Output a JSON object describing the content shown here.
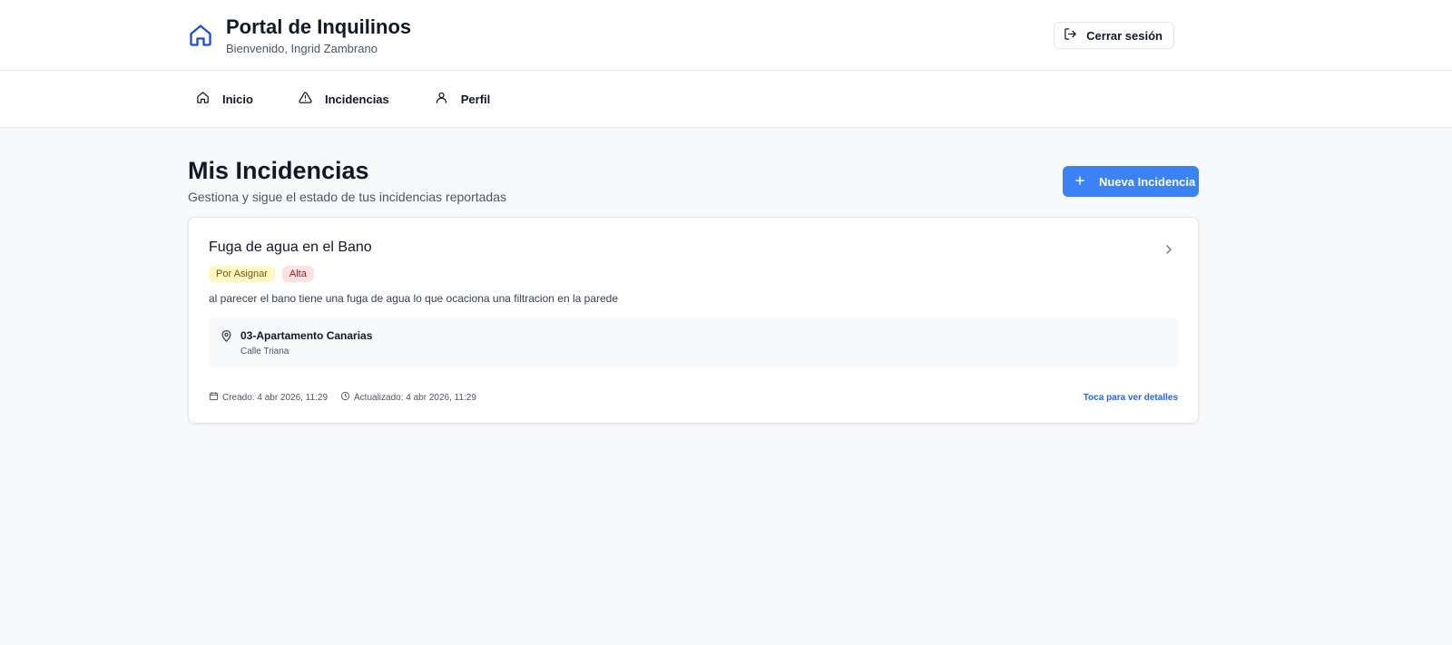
{
  "header": {
    "title": "Portal de Inquilinos",
    "welcome": "Bienvenido, Ingrid Zambrano",
    "logout_label": "Cerrar sesión"
  },
  "nav": {
    "items": [
      {
        "label": "Inicio",
        "icon": "home-icon"
      },
      {
        "label": "Incidencias",
        "icon": "warning-icon"
      },
      {
        "label": "Perfil",
        "icon": "user-icon"
      }
    ]
  },
  "page": {
    "title": "Mis Incidencias",
    "subtitle": "Gestiona y sigue el estado de tus incidencias reportadas",
    "new_button_label": "Nueva Incidencia"
  },
  "incidents": [
    {
      "title": "Fuga de agua en el Bano",
      "status": "Por Asignar",
      "priority": "Alta",
      "description": "al parecer el bano tiene una fuga de agua lo que ocaciona una filtracion en la parede",
      "property_name": "03-Apartamento Canarias",
      "property_street": "Calle Triana",
      "created": "Creado: 4 abr 2026, 11:29",
      "updated": "Actualizado: 4 abr 2026, 11:29",
      "details_link": "Toca para ver detalles"
    }
  ],
  "colors": {
    "accent": "#3b82f6",
    "link": "#2563eb",
    "status_bg": "#fef9c3",
    "priority_bg": "#fee2e2"
  }
}
